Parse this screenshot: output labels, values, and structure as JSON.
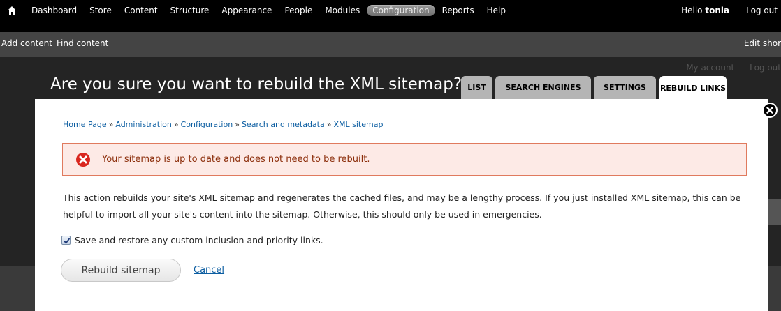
{
  "toolbar": {
    "menu": [
      "Dashboard",
      "Store",
      "Content",
      "Structure",
      "Appearance",
      "People",
      "Modules",
      "Configuration",
      "Reports",
      "Help"
    ],
    "active_item": "Configuration",
    "hello_prefix": "Hello",
    "username": "tonia",
    "logout": "Log out"
  },
  "shortcuts": {
    "items": [
      "Add content",
      "Find content"
    ],
    "edit": "Edit shor"
  },
  "background": {
    "links": [
      "My account",
      "Log out"
    ]
  },
  "overlay": {
    "title": "Are you sure you want to rebuild the XML sitemap?",
    "tabs": [
      "LIST",
      "SEARCH ENGINES",
      "SETTINGS",
      "REBUILD LINKS"
    ],
    "active_tab": "REBUILD LINKS"
  },
  "breadcrumb": [
    "Home Page",
    "Administration",
    "Configuration",
    "Search and metadata",
    "XML sitemap"
  ],
  "breadcrumb_separator": "»",
  "message": {
    "type": "error",
    "text": "Your sitemap is up to date and does not need to be rebuilt."
  },
  "description": "This action rebuilds your site's XML sitemap and regenerates the cached files, and may be a lengthy process. If you just installed XML sitemap, this can be helpful to import all your site's content into the sitemap. Otherwise, this should only be used in emergencies.",
  "checkbox": {
    "label": "Save and restore any custom inclusion and priority links.",
    "checked": true
  },
  "actions": {
    "submit": "Rebuild sitemap",
    "cancel": "Cancel"
  },
  "colors": {
    "toolbar_bg": "#000000",
    "shortcuts_bg": "#444444",
    "link": "#0b5da1",
    "error_bg": "#fdeae6",
    "error_border": "#e07a5e",
    "error_icon": "#d9271f"
  }
}
